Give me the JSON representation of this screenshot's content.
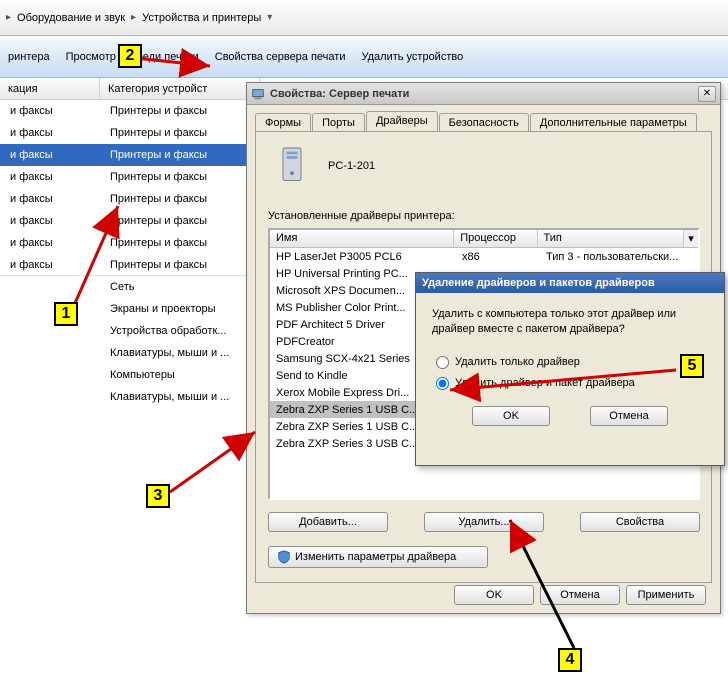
{
  "breadcrumb": {
    "item1": "Оборудование и звук",
    "item2": "Устройства и принтеры"
  },
  "toolbar": {
    "item1": "ринтера",
    "item2": "Просмотр очереди печати",
    "item3": "Свойства сервера печати",
    "item4": "Удалить устройство"
  },
  "columns": {
    "c1": "кация",
    "c2": "Категория устройст"
  },
  "devlist": {
    "rows": [
      {
        "c1": "и факсы",
        "c2": "Принтеры и факсы",
        "sel": false
      },
      {
        "c1": "и факсы",
        "c2": "Принтеры и факсы",
        "sel": false
      },
      {
        "c1": "и факсы",
        "c2": "Принтеры и факсы",
        "sel": true
      },
      {
        "c1": "и факсы",
        "c2": "Принтеры и факсы",
        "sel": false
      },
      {
        "c1": "и факсы",
        "c2": "Принтеры и факсы",
        "sel": false
      },
      {
        "c1": "и факсы",
        "c2": "Принтеры и факсы",
        "sel": false
      },
      {
        "c1": "и факсы",
        "c2": "Принтеры и факсы",
        "sel": false
      },
      {
        "c1": "и факсы",
        "c2": "Принтеры и факсы",
        "sel": false,
        "last": true
      },
      {
        "c1": "",
        "c2": "Сеть"
      },
      {
        "c1": "",
        "c2": "Экраны и проекторы"
      },
      {
        "c1": "",
        "c2": "Устройства обработк..."
      },
      {
        "c1": "",
        "c2": "Клавиатуры, мыши и ..."
      },
      {
        "c1": "",
        "c2": "Компьютеры"
      },
      {
        "c1": "",
        "c2": "Клавиатуры, мыши и ..."
      }
    ]
  },
  "dlg": {
    "title": "Свойства: Сервер печати",
    "tabs": {
      "t1": "Формы",
      "t2": "Порты",
      "t3": "Драйверы",
      "t4": "Безопасность",
      "t5": "Дополнительные параметры"
    },
    "pcname": "PC-1-201",
    "drvlabel": "Установленные драйверы принтера:",
    "drvhdr": {
      "h1": "Имя",
      "h2": "Процессор",
      "h3": "Тип"
    },
    "drivers": [
      {
        "n": "HP LaserJet P3005 PCL6",
        "p": "x86",
        "t": "Тип 3 - пользовательски...",
        "sel": false
      },
      {
        "n": "HP Universal Printing PC...",
        "p": "",
        "t": "",
        "sel": false
      },
      {
        "n": "Microsoft XPS Documen...",
        "p": "",
        "t": "",
        "sel": false
      },
      {
        "n": "MS Publisher Color Print...",
        "p": "",
        "t": "",
        "sel": false
      },
      {
        "n": "PDF Architect 5 Driver",
        "p": "",
        "t": "",
        "sel": false
      },
      {
        "n": "PDFCreator",
        "p": "",
        "t": "",
        "sel": false
      },
      {
        "n": "Samsung SCX-4x21 Series",
        "p": "",
        "t": "",
        "sel": false
      },
      {
        "n": "Send to Kindle",
        "p": "",
        "t": "",
        "sel": false
      },
      {
        "n": "Xerox Mobile Express Dri...",
        "p": "",
        "t": "",
        "sel": false
      },
      {
        "n": "Zebra ZXP Series 1 USB C...",
        "p": "",
        "t": "",
        "sel": true
      },
      {
        "n": "Zebra ZXP Series 1 USB C...",
        "p": "",
        "t": "",
        "sel": false
      },
      {
        "n": "Zebra ZXP Series 3 USB C...",
        "p": "",
        "t": "",
        "sel": false
      }
    ],
    "btns": {
      "add": "Добавить...",
      "remove": "Удалить...",
      "props": "Свойства",
      "change": "Изменить параметры драйвера",
      "ok": "OK",
      "cancel": "Отмена",
      "apply": "Применить"
    }
  },
  "confirm": {
    "title": "Удаление драйверов и пакетов драйверов",
    "msg": "Удалить с компьютера только этот драйвер или драйвер вместе с пакетом драйвера?",
    "r1": "Удалить только драйвер",
    "r2": "Удалить драйвер и пакет драйвера",
    "ok": "OK",
    "cancel": "Отмена"
  },
  "steps": {
    "s1": "1",
    "s2": "2",
    "s3": "3",
    "s4": "4",
    "s5": "5"
  }
}
